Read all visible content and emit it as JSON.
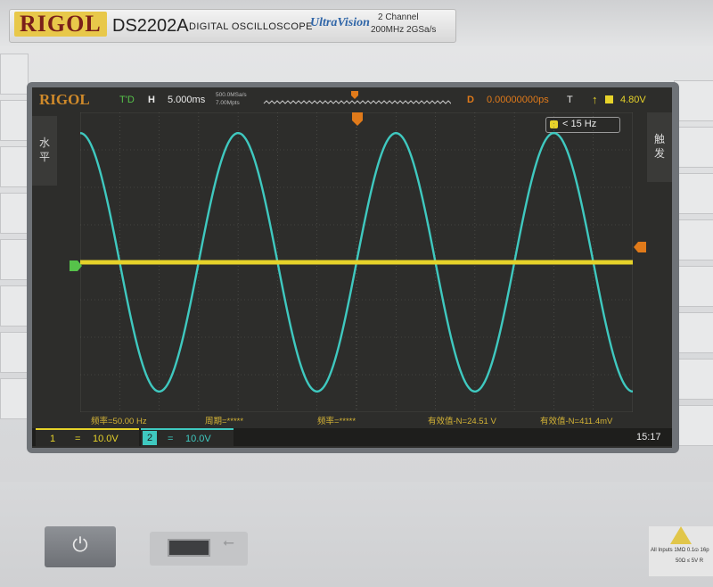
{
  "header": {
    "brand": "RIGOL",
    "model": "DS2202A",
    "description": "DIGITAL OSCILLOSCOPE",
    "series": "UltraVision",
    "spec_channels": "2 Channel",
    "spec_bandwidth": "200MHz  2GSa/s"
  },
  "screen": {
    "logo": "RIGOL",
    "run_state": "T'D",
    "timebase_label": "H",
    "timebase_value": "5.000ms",
    "sample_rate": "500.0MSa/s",
    "memory_depth": "7.00Mpts",
    "delay_label": "D",
    "delay_value": "0.00000000ps",
    "trigger_label": "T",
    "trigger_level": "4.80V",
    "trigger_freq": "< 15 Hz",
    "side_left_label": "水平",
    "side_right_label": "触发",
    "measurements": [
      "频率=50.00 Hz",
      "周期=*****",
      "频率=*****",
      "有效值-N=24.51 V",
      "有效值-N=411.4mV"
    ],
    "ch1_label": "1",
    "ch1_scale": "10.0V",
    "ch2_label": "2",
    "ch2_scale": "10.0V",
    "clock": "15:17"
  },
  "front_panel": {
    "power_icon": "power-icon",
    "warning_text": "All Inputs 1MΩ 0.1ɷ 16p",
    "warning_text2": "50Ω ≤ 5V R"
  },
  "colors": {
    "ch1": "#e6d22a",
    "ch2": "#3fc9c0",
    "grid": "#5a5a55",
    "screen_bg": "#2d2d2b",
    "accent": "#e07a1a"
  },
  "chart_data": {
    "type": "line",
    "title": "",
    "grid": true,
    "series": [
      {
        "name": "1",
        "kind": "dc",
        "level_div": 0.0
      },
      {
        "name": "2",
        "kind": "sine",
        "frequency_hz": 50.0,
        "amplitude_div": 3.45,
        "time_per_div_ms": 5.0,
        "first_peak_div": 0.0
      }
    ],
    "divisions_x": 14,
    "divisions_y": 8
  }
}
